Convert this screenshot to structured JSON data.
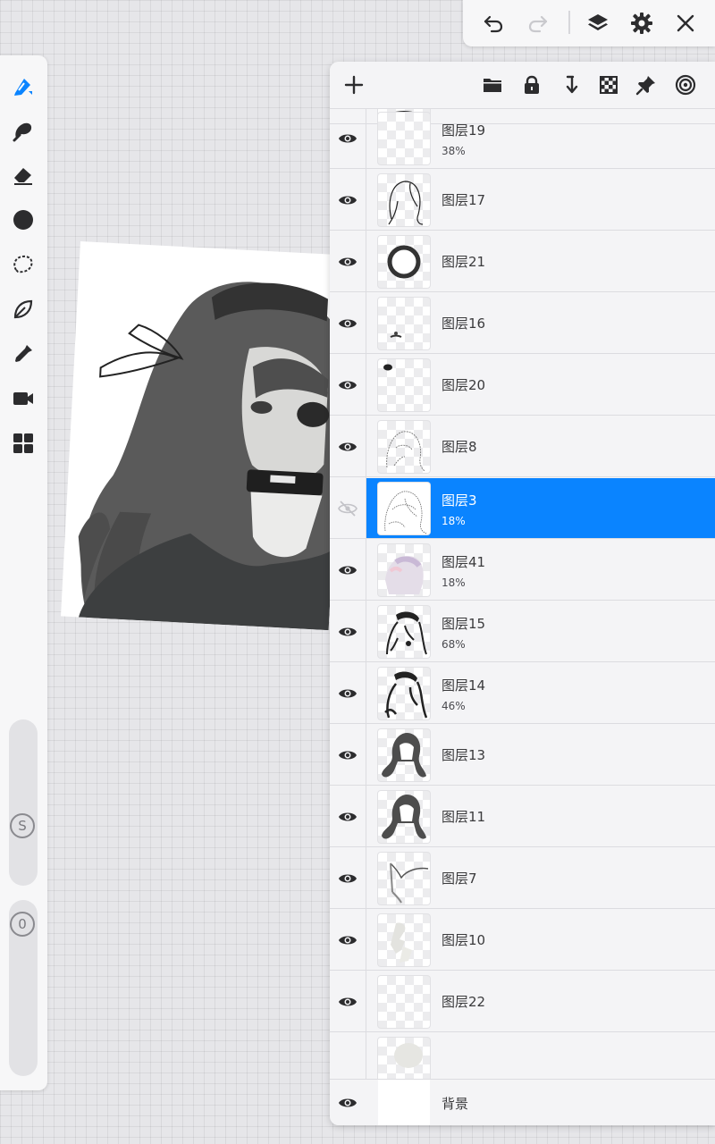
{
  "left_toolbar": {
    "tools": [
      "brush-icon",
      "smudge-icon",
      "eraser-icon",
      "color-icon",
      "selection-icon",
      "transform-icon",
      "eyedropper-icon",
      "video-icon",
      "gallery-icon"
    ],
    "size_badge": "S",
    "opacity_badge": "0"
  },
  "top_toolbar": {
    "buttons": [
      "undo-icon",
      "redo-icon",
      "layers-icon",
      "settings-icon",
      "close-icon"
    ]
  },
  "layers_toolbar": {
    "buttons": [
      "add-layer-icon",
      "folder-icon",
      "lock-icon",
      "merge-down-icon",
      "checkerboard-icon",
      "pin-icon",
      "target-icon"
    ]
  },
  "layers": [
    {
      "name": "图层19",
      "opacity": "38%",
      "visible": true,
      "selected": false
    },
    {
      "name": "图层17",
      "opacity": "",
      "visible": true,
      "selected": false
    },
    {
      "name": "图层21",
      "opacity": "",
      "visible": true,
      "selected": false
    },
    {
      "name": "图层16",
      "opacity": "",
      "visible": true,
      "selected": false
    },
    {
      "name": "图层20",
      "opacity": "",
      "visible": true,
      "selected": false
    },
    {
      "name": "图层8",
      "opacity": "",
      "visible": true,
      "selected": false
    },
    {
      "name": "图层3",
      "opacity": "18%",
      "visible": false,
      "selected": true
    },
    {
      "name": "图层41",
      "opacity": "18%",
      "visible": true,
      "selected": false
    },
    {
      "name": "图层15",
      "opacity": "68%",
      "visible": true,
      "selected": false
    },
    {
      "name": "图层14",
      "opacity": "46%",
      "visible": true,
      "selected": false
    },
    {
      "name": "图层13",
      "opacity": "",
      "visible": true,
      "selected": false
    },
    {
      "name": "图层11",
      "opacity": "",
      "visible": true,
      "selected": false
    },
    {
      "name": "图层7",
      "opacity": "",
      "visible": true,
      "selected": false
    },
    {
      "name": "图层10",
      "opacity": "",
      "visible": true,
      "selected": false
    },
    {
      "name": "图层22",
      "opacity": "",
      "visible": true,
      "selected": false
    }
  ],
  "background_layer": {
    "name": "背景",
    "visible": true
  },
  "colors": {
    "accent": "#0a84ff",
    "icon": "#2c2c2e",
    "eye_hidden": "#b8b8bd"
  }
}
